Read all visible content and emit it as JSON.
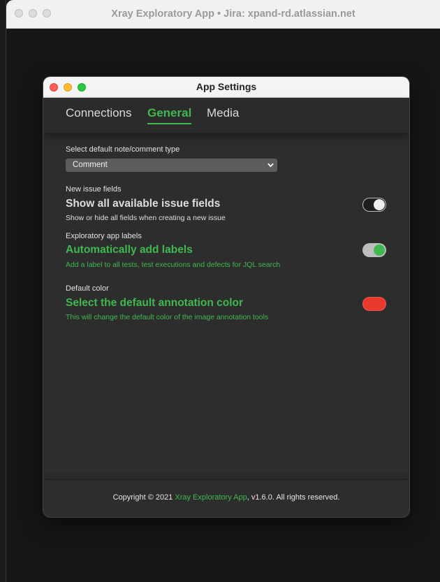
{
  "outer_window": {
    "title": "Xray Exploratory App • Jira: xpand-rd.atlassian.net"
  },
  "dialog": {
    "title": "App Settings",
    "tabs": [
      {
        "label": "Connections",
        "active": false
      },
      {
        "label": "General",
        "active": true
      },
      {
        "label": "Media",
        "active": false
      }
    ],
    "note_type": {
      "label": "Select default note/comment type",
      "selected": "Comment"
    },
    "issue_fields": {
      "section": "New issue fields",
      "title": "Show all available issue fields",
      "description": "Show or hide all fields when creating a new issue",
      "enabled": false
    },
    "labels": {
      "section": "Exploratory app labels",
      "title": "Automatically add labels",
      "description": "Add a label to all tests, test executions and defects for JQL search",
      "enabled": true
    },
    "color": {
      "section": "Default color",
      "title": "Select the default annotation color",
      "description": "This will change the default color of the image annotation tools",
      "value": "#e8392c"
    },
    "footer": {
      "prefix": "Copyright © 2021 ",
      "link": "Xray Exploratory App",
      "suffix": ", v1.6.0. All rights reserved."
    }
  },
  "colors": {
    "accent": "#3fb94f",
    "dialog_bg": "#2d2d2d",
    "annotation": "#e8392c"
  }
}
